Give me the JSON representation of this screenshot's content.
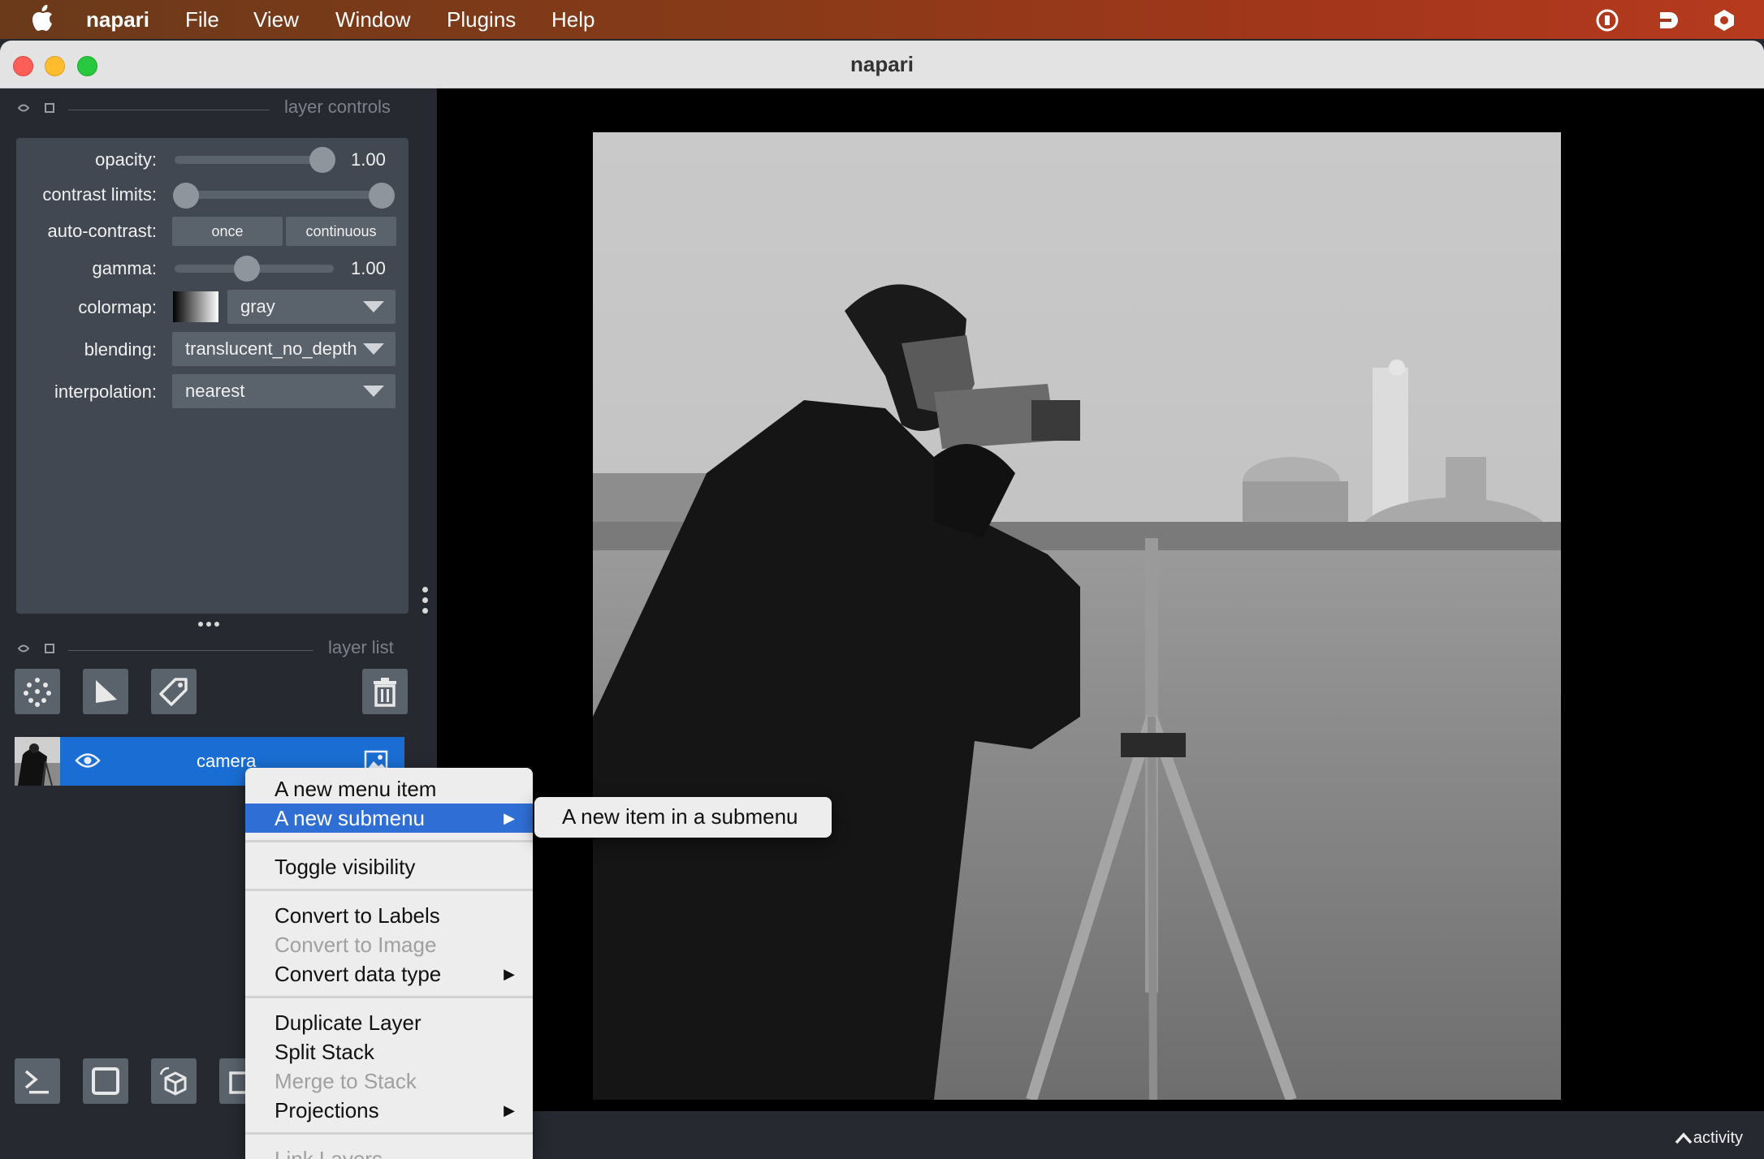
{
  "menubar": {
    "app": "napari",
    "items": [
      "File",
      "View",
      "Window",
      "Plugins",
      "Help"
    ]
  },
  "window": {
    "title": "napari"
  },
  "layer_controls": {
    "header": "layer controls",
    "opacity": {
      "label": "opacity:",
      "value": "1.00"
    },
    "contrast_limits": {
      "label": "contrast limits:"
    },
    "auto_contrast": {
      "label": "auto-contrast:",
      "once": "once",
      "continuous": "continuous"
    },
    "gamma": {
      "label": "gamma:",
      "value": "1.00"
    },
    "colormap": {
      "label": "colormap:",
      "value": "gray"
    },
    "blending": {
      "label": "blending:",
      "value": "translucent_no_depth"
    },
    "interpolation": {
      "label": "interpolation:",
      "value": "nearest"
    }
  },
  "layer_list": {
    "header": "layer list",
    "layers": [
      {
        "name": "camera"
      }
    ]
  },
  "context_menu": {
    "items": {
      "new_item": "A new menu item",
      "new_submenu": "A new submenu",
      "toggle_visibility": "Toggle visibility",
      "convert_labels": "Convert to Labels",
      "convert_image": "Convert to Image",
      "convert_dtype": "Convert data type",
      "duplicate": "Duplicate Layer",
      "split_stack": "Split Stack",
      "merge_stack": "Merge to Stack",
      "projections": "Projections",
      "link_layers": "Link Layers"
    }
  },
  "submenu": {
    "item": "A new item in a submenu"
  },
  "status": {
    "activity": "activity"
  },
  "colors": {
    "accent": "#1a6ed3",
    "menu_highlight": "#2f6fd5",
    "panel": "#262930"
  }
}
